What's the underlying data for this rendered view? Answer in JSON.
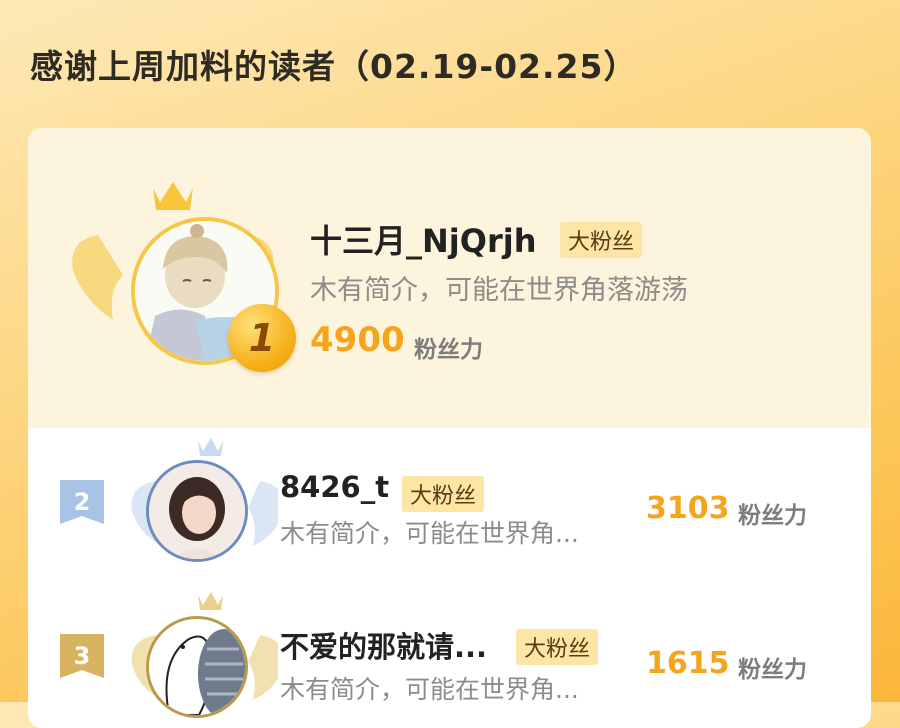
{
  "header": {
    "title": "感谢上周加料的读者（02.19-02.25）"
  },
  "colors": {
    "accent": "#f4a51b",
    "tag_bg": "#fbe6a5",
    "silver": "#9fbbe0",
    "bronze": "#d8b460"
  },
  "leaderboard": [
    {
      "rank": "1",
      "name": "十三月_NjQrjh",
      "tag": "大粉丝",
      "desc": "木有简介，可能在世界角落游荡",
      "score": "4900",
      "unit": "粉丝力"
    },
    {
      "rank": "2",
      "name": "8426_t",
      "tag": "大粉丝",
      "desc": "木有简介，可能在世界角...",
      "score": "3103",
      "unit": "粉丝力"
    },
    {
      "rank": "3",
      "name": "不爱的那就请...",
      "tag": "大粉丝",
      "desc": "木有简介，可能在世界角...",
      "score": "1615",
      "unit": "粉丝力"
    }
  ]
}
